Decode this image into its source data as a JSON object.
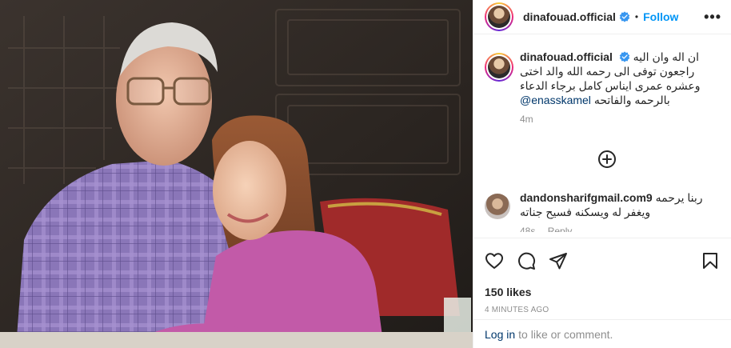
{
  "post": {
    "username": "dinafouad.official",
    "follow_label": "Follow",
    "dot": "•",
    "more_label": "•••"
  },
  "caption": {
    "username": "dinafouad.official",
    "lines": [
      "ان اله وان اليه",
      "راجعون توفى الى رحمه الله والد اختى",
      "وعشره عمرى ايناس كامل برجاء الدعاء",
      "بالرحمه والفاتحه"
    ],
    "mention": "@enasskamel",
    "time": "4m"
  },
  "comment": {
    "username": "dandonsharifgmail.com9",
    "line1": "ربنا يرحمه",
    "line2": "ويغفر له ويسكنه فسيح جناته",
    "time": "48s",
    "reply_label": "Reply"
  },
  "stats": {
    "likes": "150 likes",
    "posted_ago": "4 MINUTES AGO"
  },
  "footer": {
    "login_label": "Log in",
    "rest": "to like or comment."
  },
  "icons": {
    "verified": "verified-badge-icon",
    "more": "more-options-icon",
    "load_more": "plus-circle-icon",
    "like": "heart-icon",
    "comment": "comment-bubble-icon",
    "share": "paper-plane-icon",
    "save": "bookmark-icon"
  },
  "colors": {
    "link_blue": "#0095f6",
    "verified_blue": "#3897f0",
    "mention": "#00376b",
    "muted": "#8e8e8e"
  }
}
